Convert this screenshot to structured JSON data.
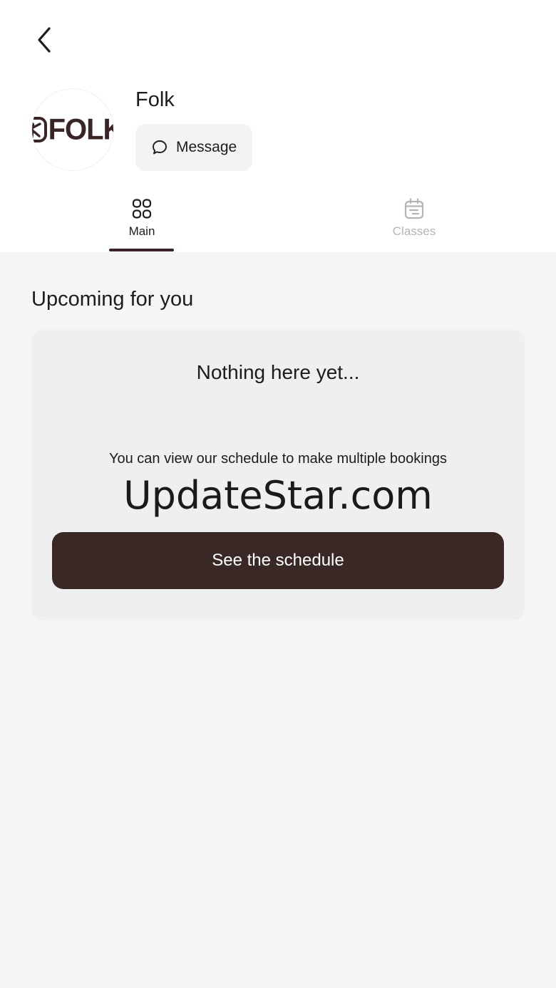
{
  "header": {
    "studio_name": "Folk",
    "logo_text": "FOLK",
    "message_label": "Message"
  },
  "tabs": [
    {
      "label": "Main",
      "active": true
    },
    {
      "label": "Classes",
      "active": false
    }
  ],
  "upcoming": {
    "title": "Upcoming for you",
    "empty_title": "Nothing here yet...",
    "empty_subtitle": "You can view our schedule to make multiple bookings",
    "watermark": "UpdateStar.com",
    "cta_label": "See the schedule"
  },
  "colors": {
    "brand": "#3a2827",
    "background": "#f5f5f5",
    "card": "#efefef",
    "inactive_tab": "#b6b3b3"
  },
  "icons": {
    "back": "chevron-left-icon",
    "message": "chat-bubble-icon",
    "main_tab": "grid-icon",
    "classes_tab": "calendar-icon"
  }
}
